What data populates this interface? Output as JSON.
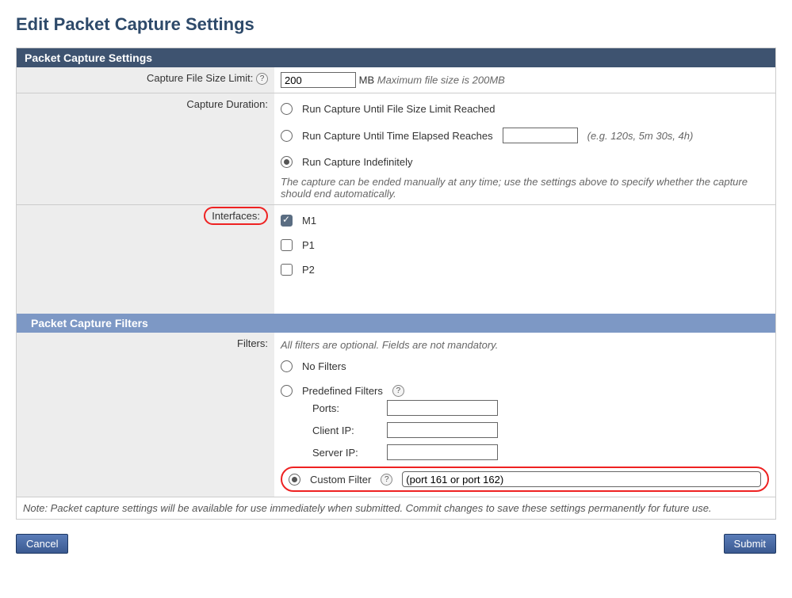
{
  "page": {
    "title": "Edit Packet Capture Settings"
  },
  "section1": {
    "title": "Packet Capture Settings"
  },
  "capture_size": {
    "label": "Capture File Size Limit:",
    "value": "200",
    "unit": "MB",
    "hint": "Maximum file size is 200MB"
  },
  "capture_duration": {
    "label": "Capture Duration:",
    "opt1": "Run Capture Until File Size Limit Reached",
    "opt2": "Run Capture Until Time Elapsed Reaches",
    "opt2_hint": "(e.g. 120s, 5m 30s, 4h)",
    "opt3": "Run Capture Indefinitely",
    "note": "The capture can be ended manually at any time; use the settings above to specify whether the capture should end automatically."
  },
  "interfaces": {
    "label": "Interfaces:",
    "m1": "M1",
    "p1": "P1",
    "p2": "P2"
  },
  "section2": {
    "title": "Packet Capture Filters"
  },
  "filters": {
    "label": "Filters:",
    "hint": "All filters are optional. Fields are not mandatory.",
    "opt_none": "No Filters",
    "opt_predef": "Predefined Filters",
    "ports_label": "Ports:",
    "client_ip_label": "Client IP:",
    "server_ip_label": "Server IP:",
    "opt_custom": "Custom Filter",
    "custom_value": "(port 161 or port 162)"
  },
  "footnote": "Note: Packet capture settings will be available for use immediately when submitted. Commit changes to save these settings permanently for future use.",
  "buttons": {
    "cancel": "Cancel",
    "submit": "Submit"
  }
}
